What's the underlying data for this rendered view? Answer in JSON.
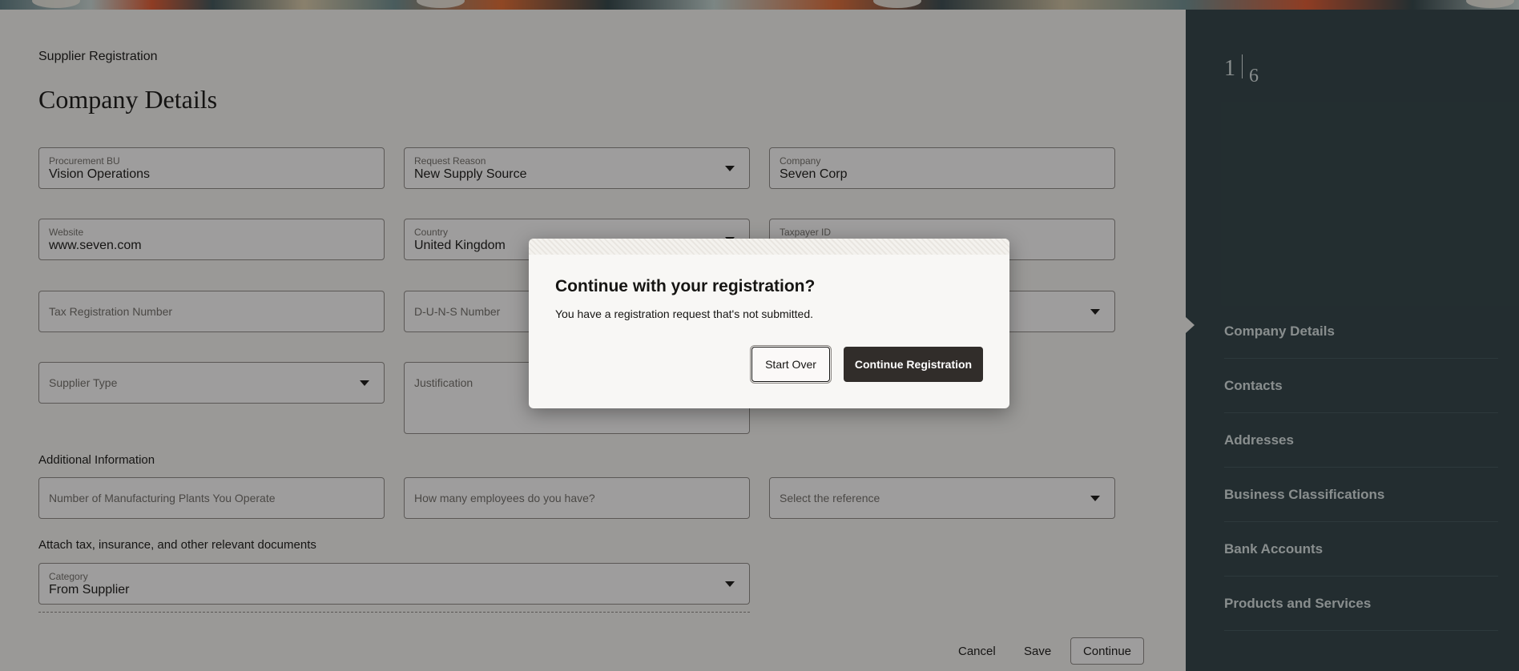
{
  "header": {
    "breadcrumb": "Supplier Registration",
    "title": "Company Details"
  },
  "fields": {
    "procurement_bu": {
      "label": "Procurement BU",
      "value": "Vision Operations"
    },
    "request_reason": {
      "label": "Request Reason",
      "value": "New Supply Source"
    },
    "company": {
      "label": "Company",
      "value": "Seven Corp"
    },
    "website": {
      "label": "Website",
      "value": "www.seven.com"
    },
    "country": {
      "label": "Country",
      "value": "United Kingdom"
    },
    "taxpayer_id": {
      "label": "Taxpayer ID",
      "value": ""
    },
    "tax_registration_number": {
      "placeholder": "Tax Registration Number"
    },
    "duns_number": {
      "placeholder": "D-U-N-S Number"
    },
    "supplier_type": {
      "placeholder": "Supplier Type"
    },
    "justification": {
      "placeholder": "Justification"
    }
  },
  "additional_info": {
    "label": "Additional Information",
    "manufacturing_plants": {
      "placeholder": "Number of Manufacturing Plants You Operate"
    },
    "employees": {
      "placeholder": "How many employees do you have?"
    },
    "reference": {
      "placeholder": "Select the reference"
    }
  },
  "attachments": {
    "label": "Attach tax, insurance, and other relevant documents",
    "category": {
      "label": "Category",
      "value": "From Supplier"
    }
  },
  "footer": {
    "cancel": "Cancel",
    "save": "Save",
    "continue": "Continue"
  },
  "sidebar": {
    "current_step": "1",
    "total_steps": "6",
    "steps": [
      {
        "label": "Company Details"
      },
      {
        "label": "Contacts"
      },
      {
        "label": "Addresses"
      },
      {
        "label": "Business Classifications"
      },
      {
        "label": "Bank Accounts"
      },
      {
        "label": "Products and Services"
      }
    ]
  },
  "dialog": {
    "title": "Continue with your registration?",
    "message": "You have a registration request that's not submitted.",
    "start_over": "Start Over",
    "continue_registration": "Continue Registration"
  },
  "colors": {
    "side_panel": "#2d3f43",
    "primary_button": "#312d2a",
    "page_background": "#f4f2ef"
  }
}
